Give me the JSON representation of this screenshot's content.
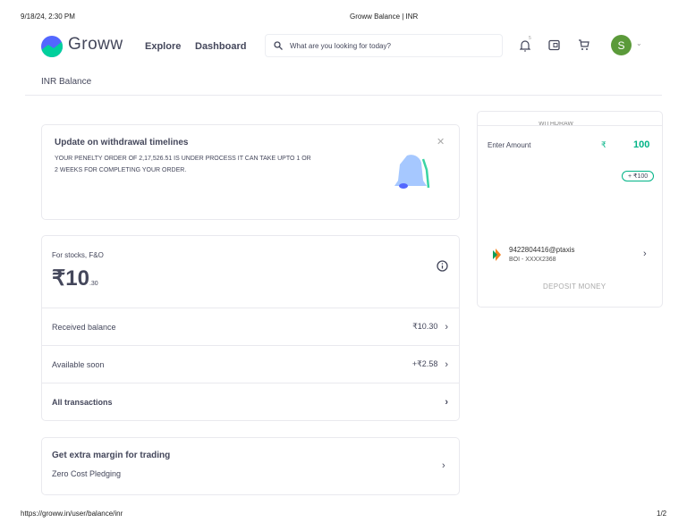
{
  "print_header": {
    "datetime": "9/18/24, 2:30 PM",
    "title": "Groww Balance | INR"
  },
  "print_footer": {
    "url": "https://groww.in/user/balance/inr",
    "page": "1/2"
  },
  "header": {
    "logo_text": "Groww",
    "nav": [
      "Explore",
      "Dashboard"
    ],
    "search_placeholder": "What are you looking for today?",
    "notification_count": "5",
    "avatar_letter": "S"
  },
  "page_title": "INR Balance",
  "alert": {
    "title": "Update on withdrawal timelines",
    "message": "YOUR PENELTY ORDER OF 2,17,526.51 IS UNDER PROCESS IT CAN TAKE UPTO 1 OR 2 WEEKS FOR COMPLETING YOUR ORDER."
  },
  "balance": {
    "label": "For stocks, F&O",
    "amount": "₹10",
    "decimals": ".30",
    "rows": [
      {
        "label": "Received balance",
        "value": "₹10.30"
      },
      {
        "label": "Available soon",
        "value": "+₹2.58"
      },
      {
        "label": "All transactions",
        "value": ""
      }
    ]
  },
  "margin": {
    "title": "Get extra margin for trading",
    "subtitle": "Zero Cost Pledging"
  },
  "withdraw": {
    "tab": "WITHDRAW",
    "enter_amount": "Enter Amount",
    "currency": "₹",
    "amount": "100",
    "quick_add": "+ ₹100",
    "upi_id": "9422804416@ptaxis",
    "bank": "BOI - XXXX2368",
    "deposit": "DEPOSIT MONEY"
  },
  "colors": {
    "accent": "#00b386",
    "brand_blue": "#5367ff",
    "avatar": "#5b9a3a"
  }
}
